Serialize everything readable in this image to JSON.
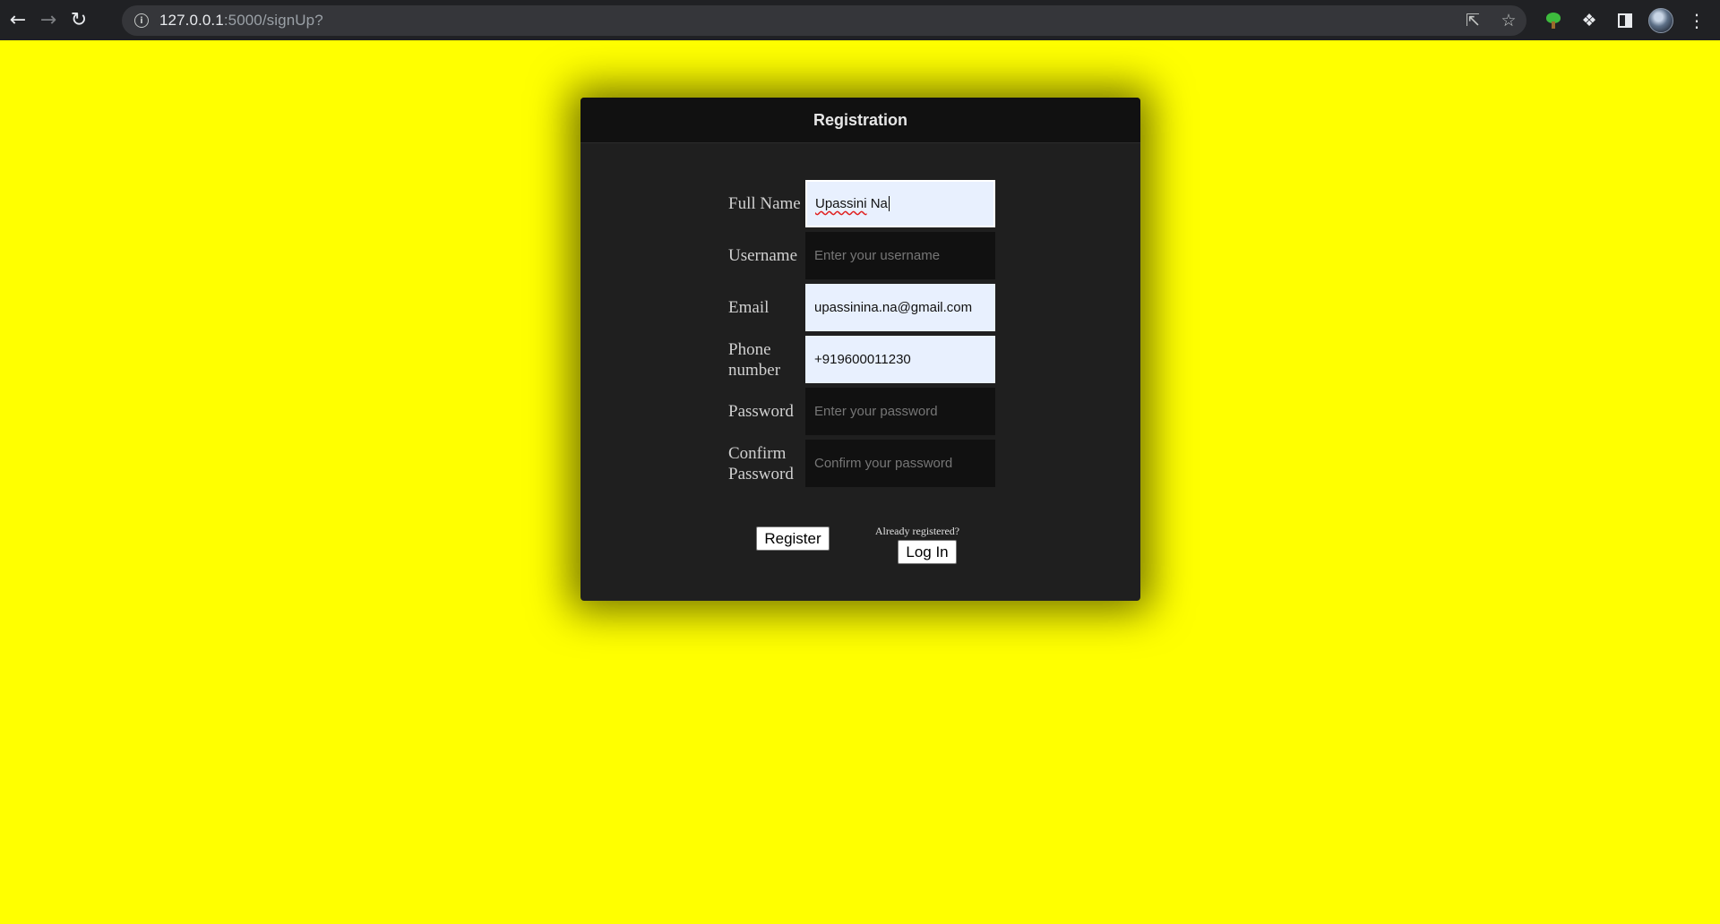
{
  "browser": {
    "url_host": "127.0.0.1",
    "url_rest": ":5000/signUp?",
    "icons": [
      "back-icon",
      "forward-icon",
      "reload-icon",
      "info-icon",
      "share-icon",
      "star-icon",
      "tree-extension-icon",
      "puzzle-icon",
      "side-panel-icon",
      "avatar",
      "menu-icon"
    ]
  },
  "form": {
    "title": "Registration",
    "fields": [
      {
        "label": "Full Name",
        "value": "Upassini Na",
        "placeholder": ""
      },
      {
        "label": "Username",
        "value": "",
        "placeholder": "Enter your username"
      },
      {
        "label": "Email",
        "value": "upassinina.na@gmail.com",
        "placeholder": ""
      },
      {
        "label": "Phone number",
        "value": "+919600011230",
        "placeholder": ""
      },
      {
        "label": "Password",
        "value": "",
        "placeholder": "Enter your password"
      },
      {
        "label": "Confirm Password",
        "value": "",
        "placeholder": "Confirm your password"
      }
    ],
    "register_label": "Register",
    "already_text": "Already registered?",
    "login_label": "Log In"
  },
  "colors": {
    "page_background": "#ffff00",
    "card_background": "#1f1f1f",
    "card_header": "#111111",
    "autofill": "#e8f0fe"
  }
}
